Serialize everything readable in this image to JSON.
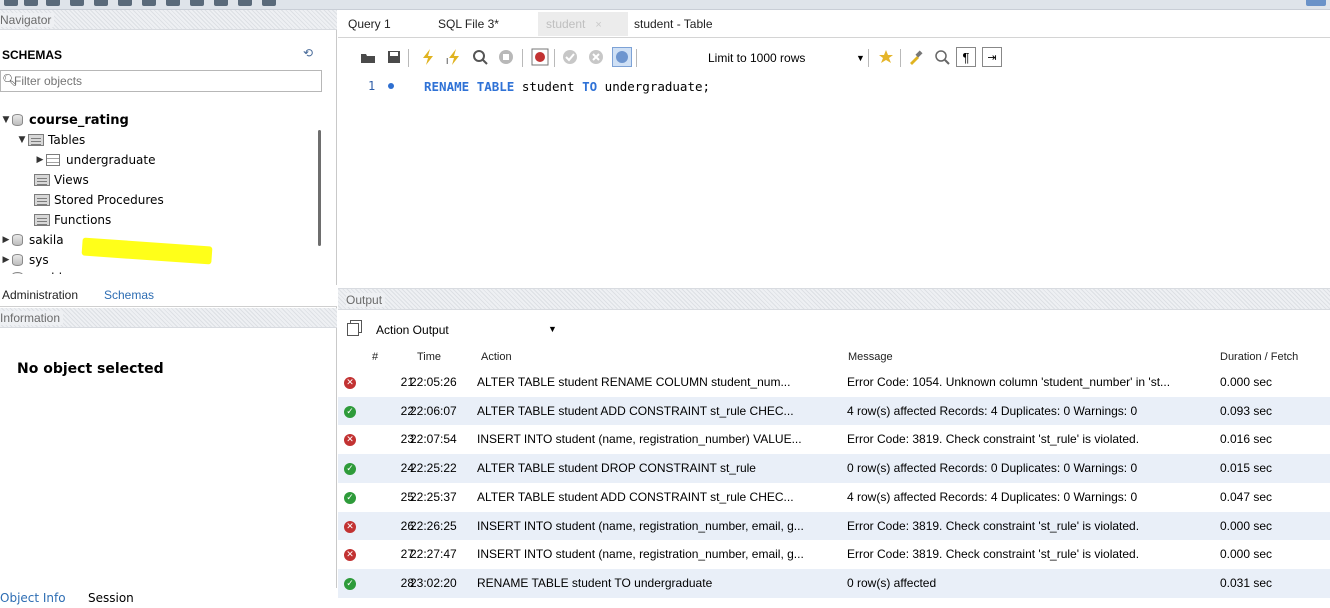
{
  "navigator": {
    "header": "Navigator",
    "schemas_label": "SCHEMAS",
    "filter_placeholder": "Filter objects",
    "tree": {
      "course_rating": "course_rating",
      "tables": "Tables",
      "undergraduate": "undergraduate",
      "views": "Views",
      "stored_procedures": "Stored Procedures",
      "functions": "Functions",
      "sakila": "sakila",
      "sys": "sys",
      "world": "world"
    },
    "tabs": {
      "administration": "Administration",
      "schemas": "Schemas"
    }
  },
  "information": {
    "header": "Information",
    "no_object": "No object selected",
    "tabs": {
      "object_info": "Object Info",
      "session": "Session"
    }
  },
  "query_tabs": [
    {
      "label": "Query 1"
    },
    {
      "label": "SQL File 3*"
    },
    {
      "label": "student",
      "close": "×"
    },
    {
      "label": "student - Table"
    }
  ],
  "toolbar": {
    "limit_label": "Limit to 1000 rows",
    "dropdown_arrow": "▼"
  },
  "editor": {
    "line_number": "1",
    "kw1": "RENAME",
    "kw2": "TABLE",
    "ident1": "student",
    "kw3": "TO",
    "ident2": "undergraduate;"
  },
  "output": {
    "header": "Output",
    "select_value": "Action Output",
    "columns": {
      "num": "#",
      "time": "Time",
      "action": "Action",
      "message": "Message",
      "duration": "Duration / Fetch"
    },
    "rows": [
      {
        "status": "error",
        "num": "21",
        "time": "22:05:26",
        "action": "ALTER TABLE student  RENAME COLUMN student_num...",
        "message": "Error Code: 1054. Unknown column 'student_number' in 'st...",
        "duration": "0.000 sec"
      },
      {
        "status": "ok",
        "num": "22",
        "time": "22:06:07",
        "action": "ALTER TABLE student ADD CONSTRAINT st_rule CHEC...",
        "message": "4 row(s) affected Records: 4  Duplicates: 0  Warnings: 0",
        "duration": "0.093 sec"
      },
      {
        "status": "error",
        "num": "23",
        "time": "22:07:54",
        "action": "INSERT INTO student (name, registration_number) VALUE...",
        "message": "Error Code: 3819. Check constraint 'st_rule' is violated.",
        "duration": "0.016 sec"
      },
      {
        "status": "ok",
        "num": "24",
        "time": "22:25:22",
        "action": "ALTER TABLE student DROP CONSTRAINT st_rule",
        "message": "0 row(s) affected Records: 0  Duplicates: 0  Warnings: 0",
        "duration": "0.015 sec"
      },
      {
        "status": "ok",
        "num": "25",
        "time": "22:25:37",
        "action": "ALTER TABLE student ADD CONSTRAINT st_rule CHEC...",
        "message": "4 row(s) affected Records: 4  Duplicates: 0  Warnings: 0",
        "duration": "0.047 sec"
      },
      {
        "status": "error",
        "num": "26",
        "time": "22:26:25",
        "action": "INSERT INTO student (name, registration_number, email, g...",
        "message": "Error Code: 3819. Check constraint 'st_rule' is violated.",
        "duration": "0.000 sec"
      },
      {
        "status": "error",
        "num": "27",
        "time": "22:27:47",
        "action": "INSERT INTO student (name, registration_number, email, g...",
        "message": "Error Code: 3819. Check constraint 'st_rule' is violated.",
        "duration": "0.000 sec"
      },
      {
        "status": "ok",
        "num": "28",
        "time": "23:02:20",
        "action": "RENAME TABLE student TO undergraduate",
        "message": "0 row(s) affected",
        "duration": "0.031 sec"
      }
    ]
  },
  "colors": {
    "keyword": "#2f72d6",
    "error": "#c23232",
    "ok": "#2e9b3a",
    "row_alt": "#e9eff8",
    "highlight": "#ffff00"
  }
}
